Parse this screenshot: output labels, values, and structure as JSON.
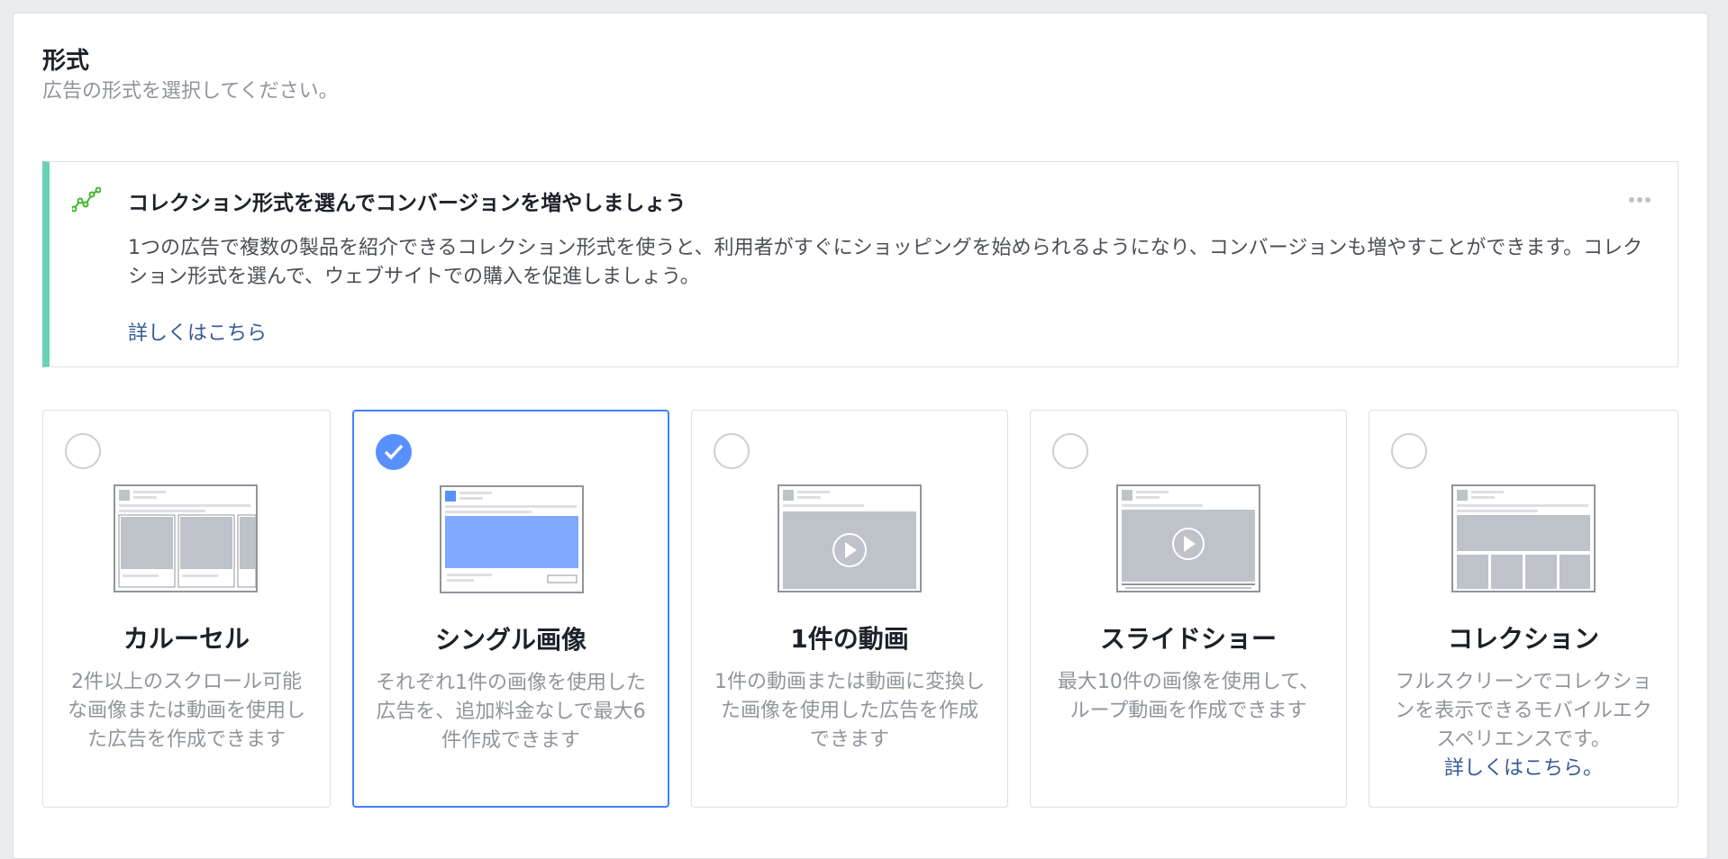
{
  "section": {
    "title": "形式",
    "subtitle": "広告の形式を選択してください。"
  },
  "banner": {
    "icon": "trend-chart-icon",
    "title": "コレクション形式を選んでコンバージョンを増やしましょう",
    "body": "1つの広告で複数の製品を紹介できるコレクション形式を使うと、利用者がすぐにショッピングを始められるようになり、コンバージョンも増やすことができます。コレクション形式を選んで、ウェブサイトでの購入を促進しましょう。",
    "link": "詳しくはこちら",
    "accent": "#6bd0b8"
  },
  "formats": [
    {
      "title": "カルーセル",
      "description": "2件以上のスクロール可能な画像または動画を使用した広告を作成できます",
      "selected": false
    },
    {
      "title": "シングル画像",
      "description": "それぞれ1件の画像を使用した広告を、追加料金なしで最大6件作成できます",
      "selected": true
    },
    {
      "title": "1件の動画",
      "description": "1件の動画または動画に変換した画像を使用した広告を作成できます",
      "selected": false
    },
    {
      "title": "スライドショー",
      "description": "最大10件の画像を使用して、ループ動画を作成できます",
      "selected": false
    },
    {
      "title": "コレクション",
      "description": "フルスクリーンでコレクションを表示できるモバイルエクスペリエンスです。",
      "link": "詳しくはこちら。",
      "selected": false
    }
  ],
  "colors": {
    "selected": "#4080ff",
    "link": "#365899",
    "muted": "#90949c"
  }
}
